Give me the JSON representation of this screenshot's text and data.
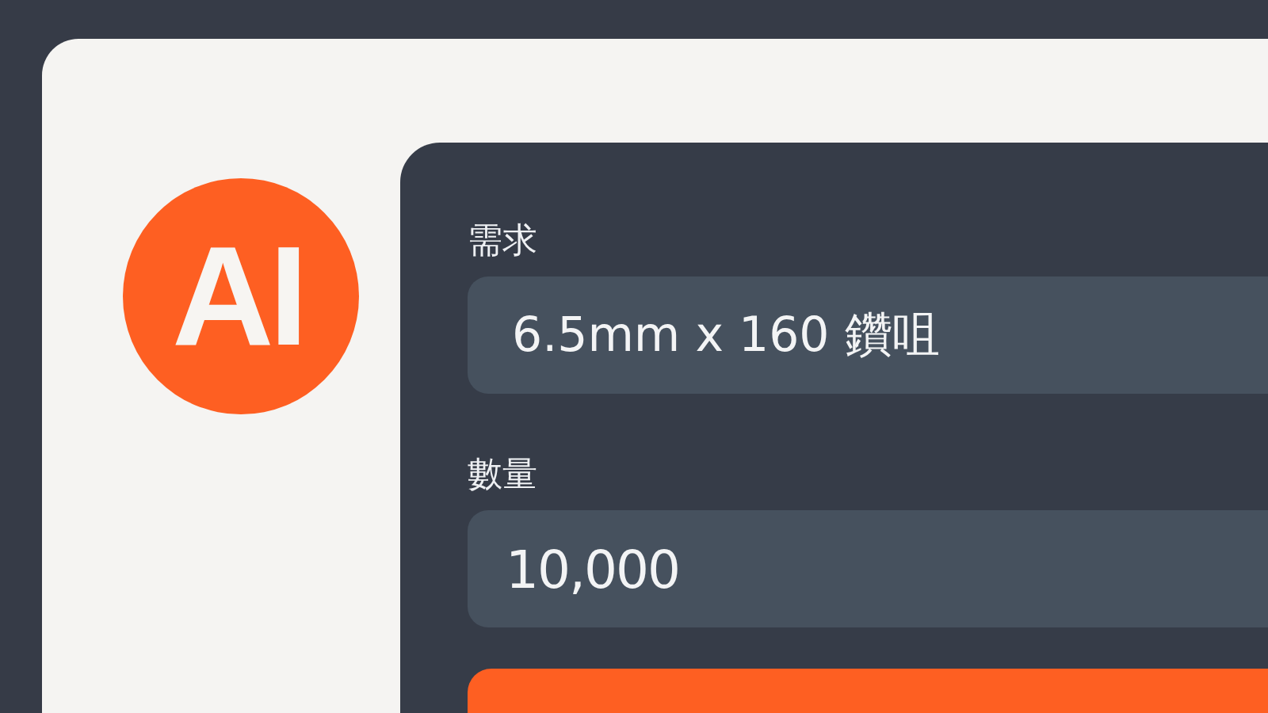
{
  "logo": {
    "text": "AI"
  },
  "form": {
    "fields": [
      {
        "label": "需求",
        "value": "6.5mm x 160 鑽咀"
      },
      {
        "label": "數量",
        "value": "10,000"
      }
    ]
  }
}
